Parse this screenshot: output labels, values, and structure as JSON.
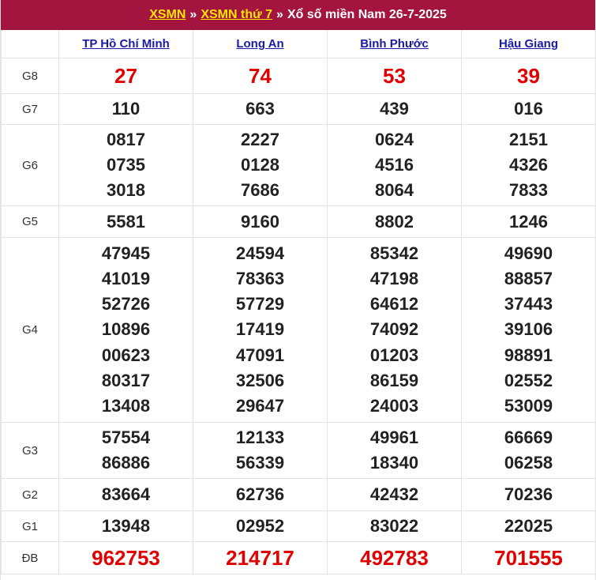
{
  "breadcrumb": {
    "link1": "XSMN",
    "sep1": "»",
    "link2": "XSMN thứ 7",
    "sep2": "»",
    "title": "Xổ số miền Nam 26-7-2025"
  },
  "provinces": [
    "TP Hồ Chí Minh",
    "Long An",
    "Bình Phước",
    "Hậu Giang"
  ],
  "prizes": [
    {
      "key": "g8",
      "label": "G8",
      "values": [
        [
          "27"
        ],
        [
          "74"
        ],
        [
          "53"
        ],
        [
          "39"
        ]
      ]
    },
    {
      "key": "g7",
      "label": "G7",
      "values": [
        [
          "110"
        ],
        [
          "663"
        ],
        [
          "439"
        ],
        [
          "016"
        ]
      ]
    },
    {
      "key": "g6",
      "label": "G6",
      "values": [
        [
          "0817",
          "0735",
          "3018"
        ],
        [
          "2227",
          "0128",
          "7686"
        ],
        [
          "0624",
          "4516",
          "8064"
        ],
        [
          "2151",
          "4326",
          "7833"
        ]
      ]
    },
    {
      "key": "g5",
      "label": "G5",
      "values": [
        [
          "5581"
        ],
        [
          "9160"
        ],
        [
          "8802"
        ],
        [
          "1246"
        ]
      ]
    },
    {
      "key": "g4",
      "label": "G4",
      "values": [
        [
          "47945",
          "41019",
          "52726",
          "10896",
          "00623",
          "80317",
          "13408"
        ],
        [
          "24594",
          "78363",
          "57729",
          "17419",
          "47091",
          "32506",
          "29647"
        ],
        [
          "85342",
          "47198",
          "64612",
          "74092",
          "01203",
          "86159",
          "24003"
        ],
        [
          "49690",
          "88857",
          "37443",
          "39106",
          "98891",
          "02552",
          "53009"
        ]
      ]
    },
    {
      "key": "g3",
      "label": "G3",
      "values": [
        [
          "57554",
          "86886"
        ],
        [
          "12133",
          "56339"
        ],
        [
          "49961",
          "18340"
        ],
        [
          "66669",
          "06258"
        ]
      ]
    },
    {
      "key": "g2",
      "label": "G2",
      "values": [
        [
          "83664"
        ],
        [
          "62736"
        ],
        [
          "42432"
        ],
        [
          "70236"
        ]
      ]
    },
    {
      "key": "g1",
      "label": "G1",
      "values": [
        [
          "13948"
        ],
        [
          "02952"
        ],
        [
          "83022"
        ],
        [
          "22025"
        ]
      ]
    },
    {
      "key": "db",
      "label": "ĐB",
      "values": [
        [
          "962753"
        ],
        [
          "214717"
        ],
        [
          "492783"
        ],
        [
          "701555"
        ]
      ]
    }
  ],
  "colors": {
    "header_bg": "#a3153f",
    "header_link": "#ffe600",
    "province_link": "#1a1aa6",
    "highlight_red": "#e00000"
  }
}
